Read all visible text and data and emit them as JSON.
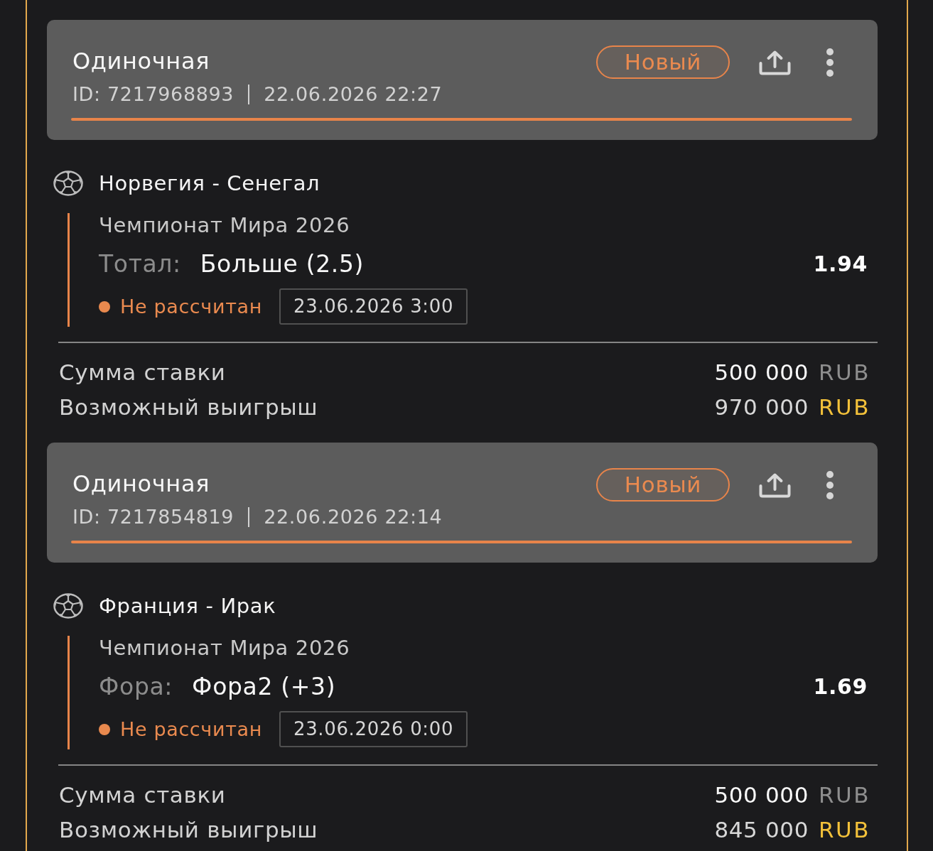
{
  "bets": [
    {
      "bet_type": "Одиночная",
      "id": "ID: 7217968893",
      "placed_at": "22.06.2026 22:27",
      "badge": "Новый",
      "event": {
        "teams": "Норвегия - Сенегал",
        "league": "Чемпионат Мира 2026",
        "market_label": "Тотал:",
        "market_value": "Больше (2.5)",
        "odds": "1.94",
        "status": "Не рассчитан",
        "start_time": "23.06.2026 3:00"
      },
      "stake": {
        "label": "Сумма ставки",
        "amount": "500 000",
        "currency": "RUB"
      },
      "potential_win": {
        "label": "Возможный выигрыш",
        "amount": "970 000",
        "currency": "RUB"
      }
    },
    {
      "bet_type": "Одиночная",
      "id": "ID: 7217854819",
      "placed_at": "22.06.2026 22:14",
      "badge": "Новый",
      "event": {
        "teams": "Франция - Ирак",
        "league": "Чемпионат Мира 2026",
        "market_label": "Фора:",
        "market_value": "Фора2 (+3)",
        "odds": "1.69",
        "status": "Не рассчитан",
        "start_time": "23.06.2026 0:00"
      },
      "stake": {
        "label": "Сумма ставки",
        "amount": "500 000",
        "currency": "RUB"
      },
      "potential_win": {
        "label": "Возможный выигрыш",
        "amount": "845 000",
        "currency": "RUB"
      }
    }
  ]
}
